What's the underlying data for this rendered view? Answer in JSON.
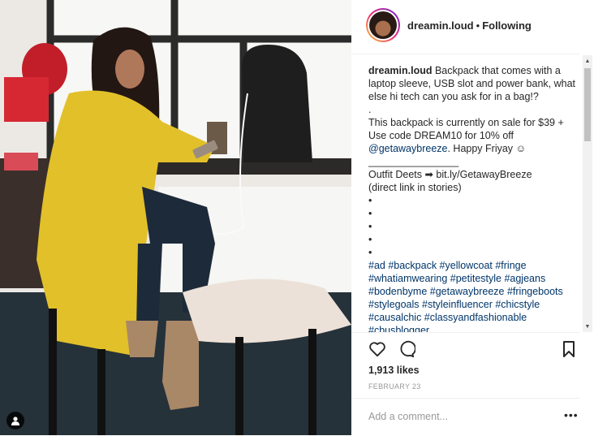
{
  "post": {
    "username": "dreamin.loud",
    "separator": "•",
    "follow_status": "Following",
    "caption_username": "dreamin.loud",
    "caption_body": " Backpack that comes with a laptop sleeve, USB slot and power bank, what else hi tech can you ask for in a bag!?\n.\nThis backpack is currently on sale for $39 + Use code DREAM10 for 10% off ",
    "mention": "@getawaybreeze",
    "caption_after_mention": ". Happy Friyay ☺\n________________\nOutfit Deets ➡ bit.ly/GetawayBreeze\n(direct link in stories)\n•\n•\n•\n•\n•\n",
    "hashtags": "#ad #backpack #yellowcoat #fringe #whatiamwearing #petitestyle #agjeans #bodenbyme #getawaybreeze #fringeboots #stylegoals #styleinfluencer #chicstyle #causalchic #classyandfashionable #cbusblogger",
    "likes": "1,913 likes",
    "date": "FEBRUARY 23",
    "comment_placeholder": "Add a comment...",
    "more_glyph": "•••"
  },
  "icons": [
    "user-tag-icon",
    "heart-icon",
    "comment-icon",
    "bookmark-icon",
    "more-options-icon"
  ],
  "colors": {
    "link": "#003569",
    "text": "#262626",
    "muted": "#999999",
    "coat": "#e2c02a"
  }
}
